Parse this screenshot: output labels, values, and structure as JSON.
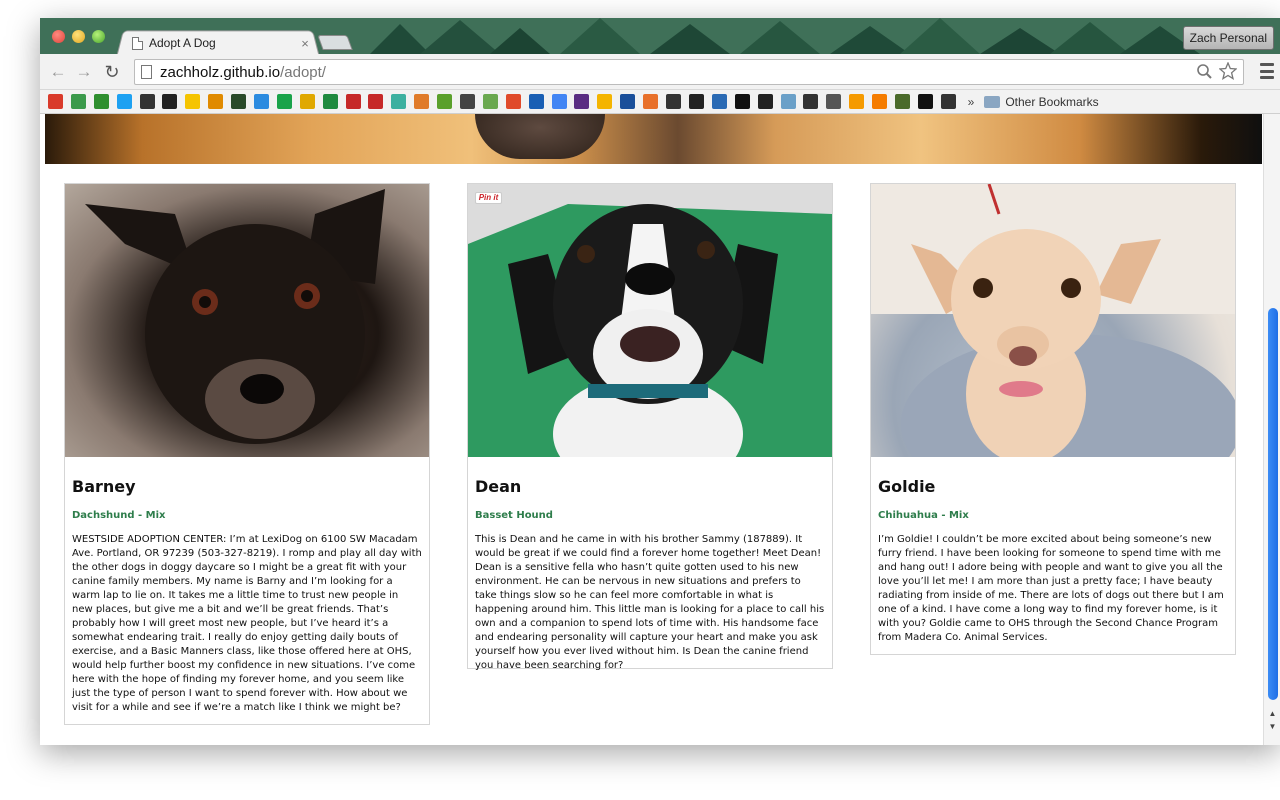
{
  "browser": {
    "tab_title": "Adopt A Dog",
    "tab_close": "×",
    "profile": "Zach Personal",
    "url_host": "zachholz.github.io",
    "url_path": "/adopt/",
    "bookmarks_more": "»",
    "other_bookmarks": "Other Bookmarks",
    "nav": {
      "back": "←",
      "forward": "→",
      "reload": "↻"
    }
  },
  "bookmark_colors": [
    "#d93a2b",
    "#3b9a4b",
    "#2f8f2f",
    "#1da1f2",
    "#333333",
    "#222222",
    "#f5c400",
    "#e08a00",
    "#2a4a2a",
    "#2c8be0",
    "#1aa34a",
    "#e0a800",
    "#1f8a3f",
    "#c62828",
    "#c62828",
    "#3cb0a0",
    "#e07b2a",
    "#5aa02c",
    "#444444",
    "#6aa84f",
    "#e04a2a",
    "#1a5fb4",
    "#4285f4",
    "#5a2d82",
    "#f4b400",
    "#1a4f9a",
    "#e8702a",
    "#333333",
    "#222222",
    "#2a6ab4",
    "#111111",
    "#222222",
    "#6aa0c8",
    "#333333",
    "#555555",
    "#f59a00",
    "#f57c00",
    "#4a6a2a",
    "#111111",
    "#333333"
  ],
  "cards": [
    {
      "name": "Barney",
      "breed": "Dachshund - Mix",
      "description": "WESTSIDE ADOPTION CENTER: I’m at LexiDog on 6100 SW Macadam Ave. Portland, OR 97239 (503-327-8219). I romp and play all day with the other dogs in doggy daycare so I might be a great fit with your canine family members. My name is Barny and I’m looking for a warm lap to lie on. It takes me a little time to trust new people in new places, but give me a bit and we’ll be great friends. That’s probably how I will greet most new people, but I’ve heard it’s a somewhat endearing trait. I really do enjoy getting daily bouts of exercise, and a Basic Manners class, like those offered here at OHS, would help further boost my confidence in new situations. I’ve come here with the hope of finding my forever home, and you seem like just the type of person I want to spend forever with. How about we visit for a while and see if we’re a match like I think we might be?"
    },
    {
      "name": "Dean",
      "breed": "Basset Hound",
      "pin_label": "Pin it",
      "description": "This is Dean and he came in with his brother Sammy (187889). It would be great if we could find a forever home together! Meet Dean! Dean is a sensitive fella who hasn’t quite gotten used to his new environment. He can be nervous in new situations and prefers to take things slow so he can feel more comfortable in what is happening around him. This little man is looking for a place to call his own and a companion to spend lots of time with. His handsome face and endearing personality will capture your heart and make you ask yourself how you ever lived without him. Is Dean the canine friend you have been searching for?"
    },
    {
      "name": "Goldie",
      "breed": "Chihuahua - Mix",
      "description": "I’m Goldie! I couldn’t be more excited about being someone’s new furry friend. I have been looking for someone to spend time with me and hang out! I adore being with people and want to give you all the love you’ll let me! I am more than just a pretty face; I have beauty radiating from inside of me. There are lots of dogs out there but I am one of a kind. I have come a long way to find my forever home, is it with you? Goldie came to OHS through the Second Chance Program from Madera Co. Animal Services."
    }
  ]
}
